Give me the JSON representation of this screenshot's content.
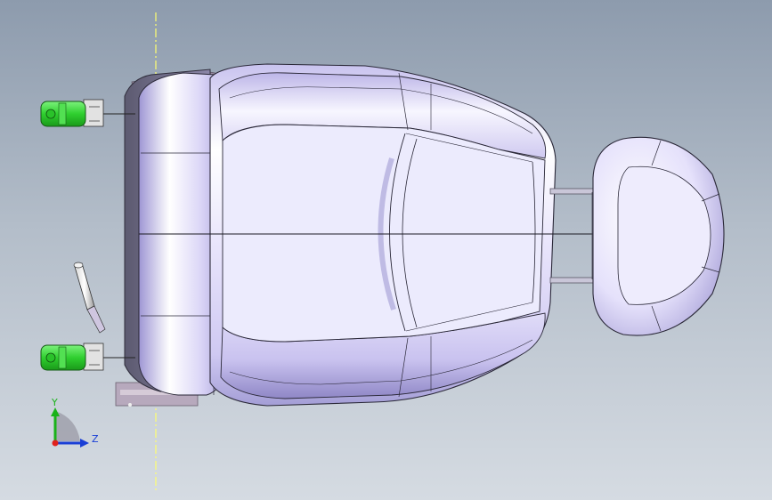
{
  "axis_triad": {
    "y_label": "Y",
    "z_label": "Z",
    "x_color": "#e0201c",
    "y_color": "#19b219",
    "z_color": "#1a3fd6"
  },
  "colors": {
    "background_top": "#8d9bad",
    "background_bottom": "#d5dbe2",
    "seat_surface": "#d9d4f4",
    "seat_shadow": "#8e86c4",
    "bracket_green": "#3fd83f",
    "plane_line": "#ffff66"
  },
  "model_parts": [
    "seat-cushion",
    "seat-back-frame",
    "headrest",
    "headrest-posts",
    "mounting-bracket-left",
    "mounting-bracket-right",
    "adjustment-lever"
  ]
}
